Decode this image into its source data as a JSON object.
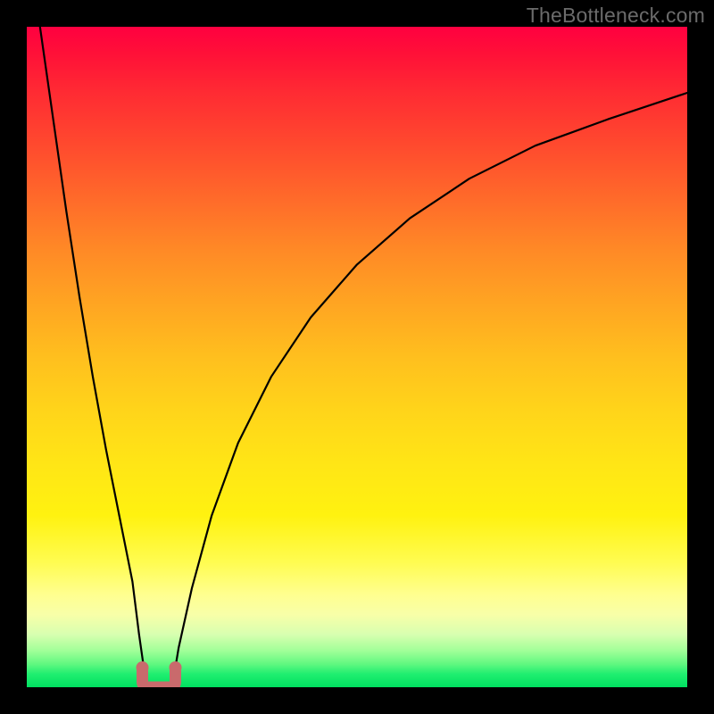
{
  "watermark": "TheBottleneck.com",
  "chart_data": {
    "type": "line",
    "title": "",
    "xlabel": "",
    "ylabel": "",
    "xlim": [
      0,
      100
    ],
    "ylim": [
      0,
      100
    ],
    "series": [
      {
        "name": "bottleneck-curve",
        "x": [
          0,
          2,
          4,
          6,
          8,
          10,
          12,
          14,
          16,
          17,
          18,
          19,
          20,
          21,
          22,
          23,
          25,
          28,
          32,
          37,
          43,
          50,
          58,
          67,
          77,
          88,
          100
        ],
        "values": [
          115,
          100,
          86,
          72,
          59,
          47,
          36,
          26,
          16,
          8,
          1,
          -1,
          -2,
          -1,
          0,
          6,
          15,
          26,
          37,
          47,
          56,
          64,
          71,
          77,
          82,
          86,
          90
        ]
      }
    ],
    "annotations": [
      {
        "name": "valley-marker",
        "x_range": [
          17.5,
          22.5
        ],
        "y": 0,
        "color": "#c96a6c"
      }
    ],
    "background": {
      "type": "vertical-gradient",
      "stops": [
        {
          "pos": 0.0,
          "color": "#ff0040"
        },
        {
          "pos": 0.5,
          "color": "#ffbf1e"
        },
        {
          "pos": 0.86,
          "color": "#ffff90"
        },
        {
          "pos": 1.0,
          "color": "#00e060"
        }
      ]
    }
  }
}
